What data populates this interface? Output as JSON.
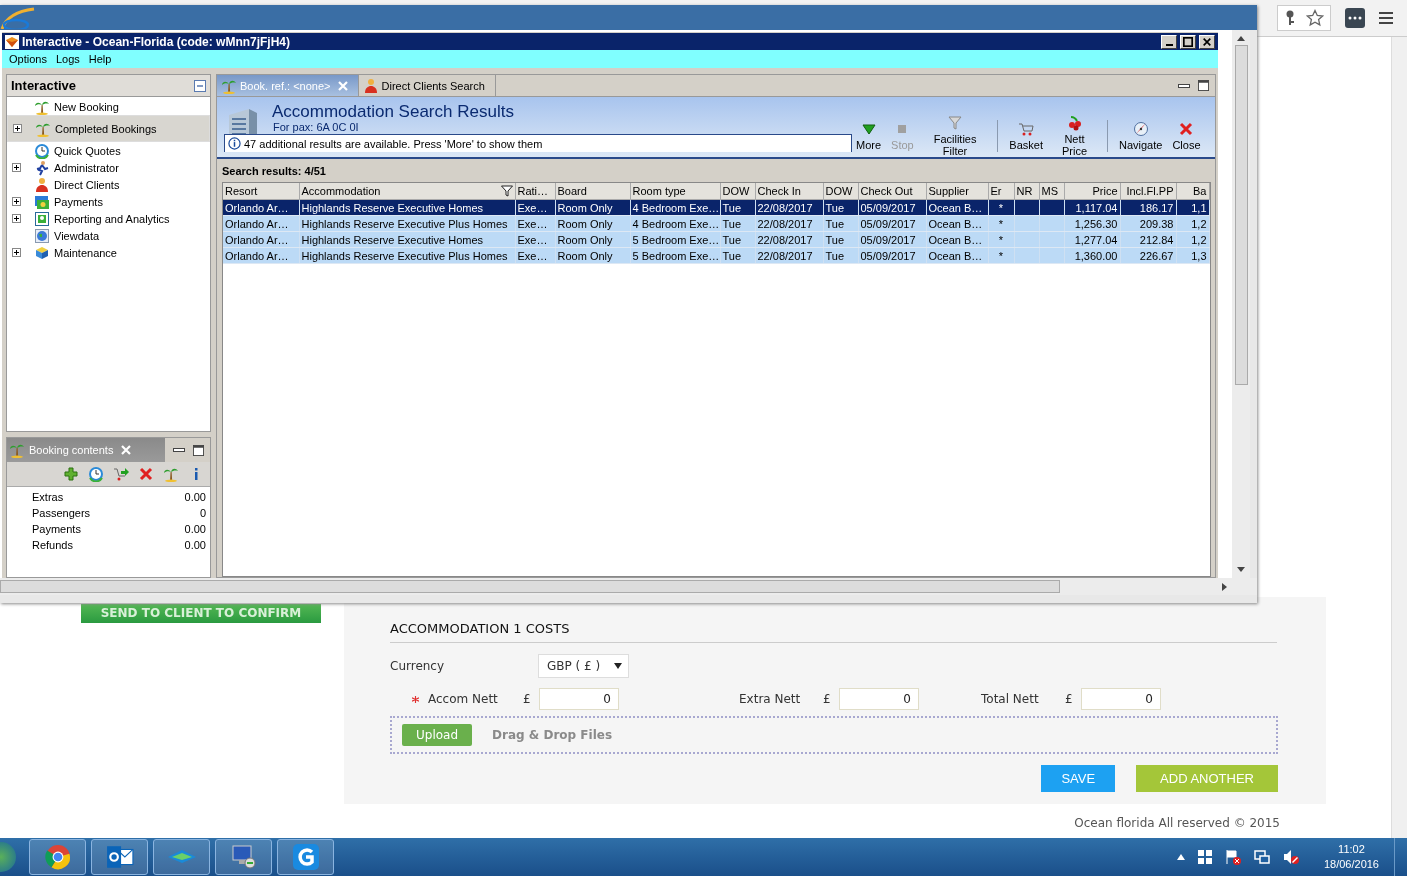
{
  "app_window": {
    "title": "Interactive - Ocean-Florida (code: wMnn7jFjH4)"
  },
  "menu": [
    "Options",
    "Logs",
    "Help"
  ],
  "nav_panel": {
    "title": "Interactive",
    "items": [
      {
        "label": "New Booking",
        "expandable": false,
        "selected": false
      },
      {
        "label": "Completed Bookings",
        "expandable": true,
        "selected": true
      },
      {
        "label": "Quick Quotes",
        "expandable": false,
        "selected": false
      },
      {
        "label": "Administrator",
        "expandable": true,
        "selected": false
      },
      {
        "label": "Direct Clients",
        "expandable": false,
        "selected": false
      },
      {
        "label": "Payments",
        "expandable": true,
        "selected": false
      },
      {
        "label": "Reporting and Analytics",
        "expandable": true,
        "selected": false
      },
      {
        "label": "Viewdata",
        "expandable": false,
        "selected": false
      },
      {
        "label": "Maintenance",
        "expandable": true,
        "selected": false
      }
    ]
  },
  "booking_panel": {
    "tab": "Booking contents",
    "rows": [
      {
        "label": "Extras",
        "value": "0.00"
      },
      {
        "label": "Passengers",
        "value": "0"
      },
      {
        "label": "Payments",
        "value": "0.00"
      },
      {
        "label": "Refunds",
        "value": "0.00"
      }
    ]
  },
  "tabs": [
    {
      "label": "Book. ref.: <none>",
      "selected": true,
      "closable": true
    },
    {
      "label": "Direct Clients Search",
      "selected": false,
      "closable": false
    }
  ],
  "results": {
    "title": "Accommodation Search Results",
    "subtitle": "For pax: 6A  0C  0I",
    "info": "47 additional results are available. Press 'More' to show them",
    "count_label": "Search results: 4/51",
    "toolbar": [
      {
        "label": "More",
        "disabled": false,
        "separator_before": false
      },
      {
        "label": "Stop",
        "disabled": true,
        "separator_before": false
      },
      {
        "label": "Facilities Filter",
        "disabled": false,
        "separator_before": false
      },
      {
        "label": "Basket",
        "disabled": false,
        "separator_before": true
      },
      {
        "label": "Nett Price",
        "disabled": false,
        "separator_before": false
      },
      {
        "label": "Navigate",
        "disabled": false,
        "separator_before": true
      },
      {
        "label": "Close",
        "disabled": false,
        "separator_before": false
      }
    ]
  },
  "table": {
    "columns": [
      {
        "label": "Resort",
        "filtered": false
      },
      {
        "label": "Accommodation",
        "filtered": true
      },
      {
        "label": "Rati…",
        "filtered": false
      },
      {
        "label": "Board",
        "filtered": false
      },
      {
        "label": "Room type",
        "filtered": false
      },
      {
        "label": "DOW",
        "filtered": false
      },
      {
        "label": "Check In",
        "filtered": false
      },
      {
        "label": "DOW",
        "filtered": false
      },
      {
        "label": "Check Out",
        "filtered": false
      },
      {
        "label": "Supplier",
        "filtered": false
      },
      {
        "label": "Er",
        "filtered": false
      },
      {
        "label": "NR",
        "filtered": false
      },
      {
        "label": "MS",
        "filtered": false
      },
      {
        "label": "Price",
        "filtered": false
      },
      {
        "label": "Incl.Fl.PP",
        "filtered": false
      },
      {
        "label": "Ba",
        "filtered": false
      }
    ],
    "rows": [
      {
        "selected": true,
        "cells": [
          "Orlando Ar…",
          "Highlands Reserve Executive Homes",
          "Exe…",
          "Room Only",
          "4 Bedroom Exe…",
          "Tue",
          "22/08/2017",
          "Tue",
          "05/09/2017",
          "Ocean B…",
          "*",
          "",
          "",
          "1,117.04",
          "186.17",
          "1,1"
        ]
      },
      {
        "selected": false,
        "cells": [
          "Orlando Ar…",
          "Highlands Reserve Executive Plus Homes",
          "Exe…",
          "Room Only",
          "4 Bedroom Exe…",
          "Tue",
          "22/08/2017",
          "Tue",
          "05/09/2017",
          "Ocean B…",
          "*",
          "",
          "",
          "1,256.30",
          "209.38",
          "1,2"
        ]
      },
      {
        "selected": false,
        "cells": [
          "Orlando Ar…",
          "Highlands Reserve Executive Homes",
          "Exe…",
          "Room Only",
          "5 Bedroom Exe…",
          "Tue",
          "22/08/2017",
          "Tue",
          "05/09/2017",
          "Ocean B…",
          "*",
          "",
          "",
          "1,277.04",
          "212.84",
          "1,2"
        ]
      },
      {
        "selected": false,
        "cells": [
          "Orlando Ar…",
          "Highlands Reserve Executive Plus Homes",
          "Exe…",
          "Room Only",
          "5 Bedroom Exe…",
          "Tue",
          "22/08/2017",
          "Tue",
          "05/09/2017",
          "Ocean B…",
          "*",
          "",
          "",
          "1,360.00",
          "226.67",
          "1,3"
        ]
      }
    ]
  },
  "send_button": "SEND TO CLIENT TO CONFIRM",
  "form": {
    "heading": "ACCOMMODATION 1 COSTS",
    "currency_label": "Currency",
    "currency": "GBP ( £ )",
    "fields": [
      {
        "label": "Accom Nett",
        "required": true,
        "symbol": "£",
        "value": "0"
      },
      {
        "label": "Extra Nett",
        "required": false,
        "symbol": "£",
        "value": "0"
      },
      {
        "label": "Total Nett",
        "required": false,
        "symbol": "£",
        "value": "0"
      }
    ],
    "upload_button": "Upload",
    "drop_hint": "Drag & Drop Files",
    "buttons": [
      {
        "label": "SAVE",
        "kind": "primary"
      },
      {
        "label": "ADD ANOTHER",
        "kind": "secondary"
      }
    ]
  },
  "footer": "Ocean florida All reserved © 2015",
  "taskbar": {
    "time": "11:02",
    "date": "18/06/2016"
  }
}
